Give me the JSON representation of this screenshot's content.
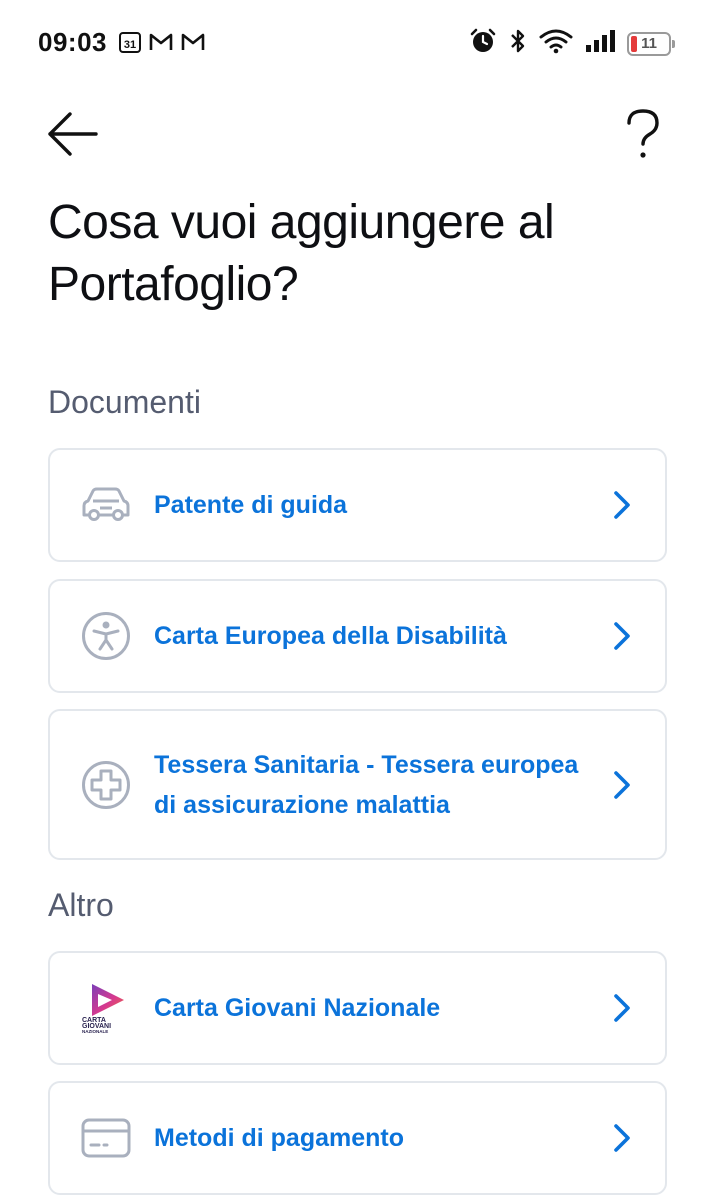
{
  "status_bar": {
    "time": "09:03",
    "calendar_day": "31",
    "battery_level": "11",
    "icons": [
      "calendar-icon",
      "gmail-icon",
      "gmail-icon",
      "alarm-icon",
      "bluetooth-icon",
      "wifi-icon",
      "signal-icon",
      "battery-icon"
    ]
  },
  "nav": {
    "back_icon": "arrow-left-icon",
    "help_icon": "question-mark-icon"
  },
  "page": {
    "title": "Cosa vuoi aggiungere al Portafoglio?"
  },
  "sections": {
    "documenti": {
      "title": "Documenti",
      "items": [
        {
          "label": "Patente di guida",
          "icon": "car-icon"
        },
        {
          "label": "Carta Europea della Disabilità",
          "icon": "accessibility-icon"
        },
        {
          "label": "Tessera Sanitaria - Tessera europea di assicurazione malattia",
          "icon": "health-cross-icon"
        }
      ]
    },
    "altro": {
      "title": "Altro",
      "items": [
        {
          "label": "Carta Giovani Nazionale",
          "icon": "carta-giovani-logo",
          "logo_text": [
            "CARTA",
            "GIOVANI",
            "NAZIONALE"
          ]
        },
        {
          "label": "Metodi di pagamento",
          "icon": "payment-card-icon"
        }
      ]
    }
  },
  "colors": {
    "accent": "#0b73da",
    "icon_gray": "#a9b0be",
    "section_gray": "#555c70",
    "card_border": "#e3e7ec"
  }
}
